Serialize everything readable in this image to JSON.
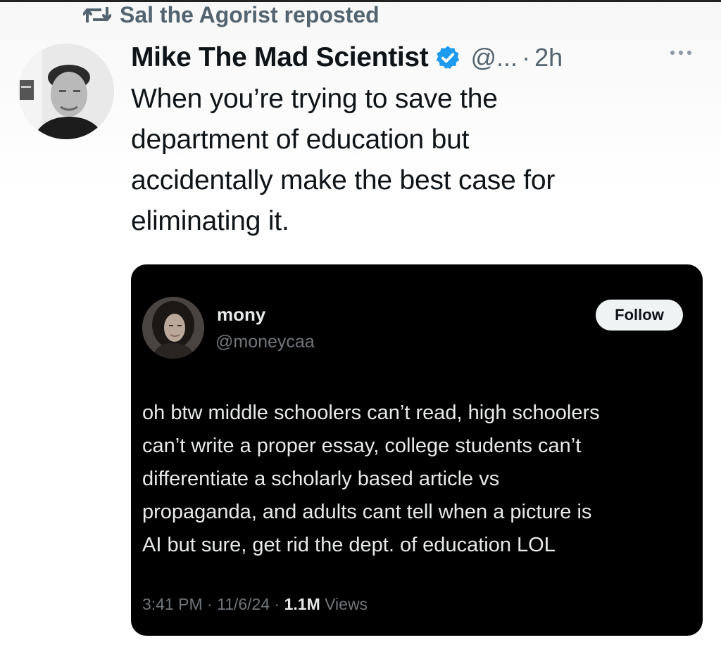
{
  "repost": {
    "icon": "repost-icon",
    "text": "Sal the Agorist reposted"
  },
  "tweet": {
    "author": {
      "display_name": "Mike The Mad Scientist",
      "verified": true,
      "handle": "@...",
      "separator": "·",
      "time": "2h"
    },
    "more_icon": "more-options-icon",
    "text_lines": [
      "When you’re trying to save the",
      "department of education but",
      "accidentally make the best case for",
      "eliminating it."
    ]
  },
  "quote": {
    "author": {
      "display_name": "mony",
      "handle": "@moneycaa"
    },
    "follow_label": "Follow",
    "text_lines": [
      "oh btw middle schoolers can’t read, high schoolers",
      "can’t write a proper essay, college students can’t",
      "differentiate a scholarly based article vs",
      "propaganda, and adults cant tell when a picture is",
      "AI but sure, get rid the dept. of education LOL"
    ],
    "meta": {
      "time": "3:41 PM",
      "separator": " · ",
      "date": "11/6/24",
      "views_count": "1.1M",
      "views_label": " Views"
    }
  },
  "colors": {
    "verified": "#1d9bf0",
    "secondary_text": "#536471",
    "quote_background": "#000000"
  }
}
